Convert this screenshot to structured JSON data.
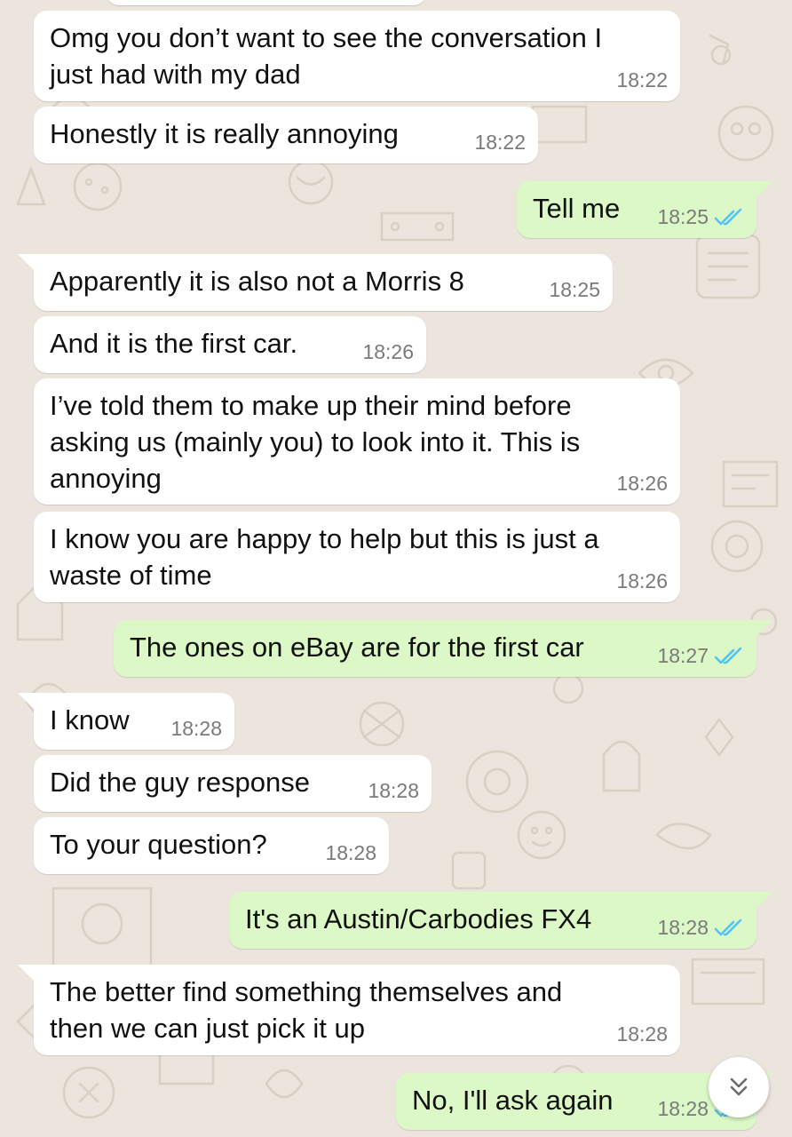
{
  "colors": {
    "incoming_bubble": "#ffffff",
    "outgoing_bubble": "#dcf8c6",
    "read_tick": "#4fc3f7",
    "timestamp": "#7a7a7a",
    "wallpaper": "#ece5dd"
  },
  "messages": [
    {
      "direction": "in",
      "text": "Omg you don’t want to see the conversation I\njust had with my dad",
      "time": "18:22"
    },
    {
      "direction": "in",
      "text": "Honestly it is really annoying",
      "time": "18:22"
    },
    {
      "direction": "out",
      "text": "Tell me",
      "time": "18:25",
      "status": "read"
    },
    {
      "direction": "in",
      "text": "Apparently it is also not a Morris 8",
      "time": "18:25"
    },
    {
      "direction": "in",
      "text": "And it is the first car.",
      "time": "18:26"
    },
    {
      "direction": "in",
      "text": "I’ve told them to make up their mind before\nasking us (mainly you) to look into it. This is\nannoying",
      "time": "18:26"
    },
    {
      "direction": "in",
      "text": "I know you are happy to help but this is just a\nwaste of time",
      "time": "18:26"
    },
    {
      "direction": "out",
      "text": "The ones on eBay are for the first car",
      "time": "18:27",
      "status": "read"
    },
    {
      "direction": "in",
      "text": "I know",
      "time": "18:28"
    },
    {
      "direction": "in",
      "text": "Did the guy response",
      "time": "18:28"
    },
    {
      "direction": "in",
      "text": "To your question?",
      "time": "18:28"
    },
    {
      "direction": "out",
      "text": "It's an Austin/Carbodies FX4",
      "time": "18:28",
      "status": "read"
    },
    {
      "direction": "in",
      "text": "The better find something themselves and\nthen we can just pick it up",
      "time": "18:28"
    },
    {
      "direction": "out",
      "text": "No, I'll ask again",
      "time": "18:28",
      "status": "read"
    }
  ],
  "scroll_button": {
    "icon": "double-chevron-down-icon"
  }
}
